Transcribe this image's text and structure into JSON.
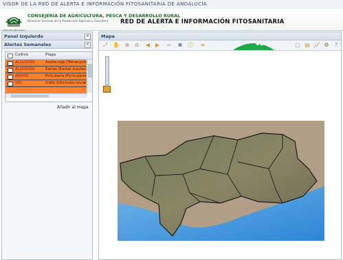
{
  "app": {
    "window_title": "VISOR DE LA RED DE ALERTA E INFORMACIÓN FITOSANITARIA DE ANDALUCÍA"
  },
  "header": {
    "logo_caption": "JUNTA DE ANDALUCIA",
    "consejeria": "CONSEJERÍA DE AGRICULTURA, PESCA Y DESARROLLO RURAL",
    "direccion": "Dirección General de la Producción Agrícola y Ganadera",
    "red_title": "RED DE ALERTA E INFORMACIÓN FITOSANITARIA"
  },
  "left_panel": {
    "title": "Panel Izquierdo",
    "collapse_symbol": "«",
    "alertas": {
      "title": "Alertas Semanales",
      "collapse_symbol": "«",
      "columns": [
        "Cultivo",
        "Plaga"
      ],
      "rows": [
        {
          "cultivo": "ALGODÓN",
          "plaga": "Araña roja (Tetranychus..."
        },
        {
          "cultivo": "ALGODÓN",
          "plaga": "Earias (Earias insulana)"
        },
        {
          "cultivo": "ARROZ",
          "plaga": "Piricularia (Pyricularia or..."
        },
        {
          "cultivo": "VID",
          "plaga": "Oídio (Uncinula necator)"
        }
      ],
      "add_button": "Añadir al mapa"
    }
  },
  "map_panel": {
    "title": "Mapa",
    "toolbar_left": [
      "zoom-extent-icon",
      "pan-icon",
      "zoom-in-icon",
      "zoom-out-icon",
      "back-icon",
      "forward-icon",
      "ruler-distance-icon",
      "ruler-area-icon",
      "info-icon",
      "binoculars-icon"
    ],
    "toolbar_right": [
      "print-icon",
      "layers-icon",
      "chart-icon",
      "settings-icon",
      "help-icon"
    ],
    "zoom_level": 0.1
  },
  "colors": {
    "alert_row": "#ff7f2a",
    "header_green": "#1f6b2a",
    "panel_header": "#d5dde7"
  }
}
